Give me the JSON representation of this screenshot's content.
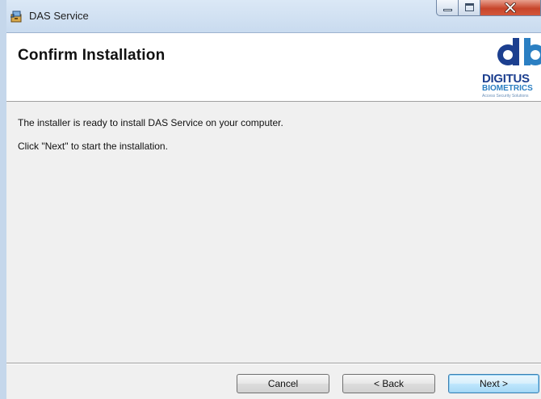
{
  "window": {
    "title": "DAS Service"
  },
  "banner": {
    "title": "Confirm Installation",
    "logo": {
      "name": "DIGITUS",
      "subtitle": "BIOMETRICS",
      "tagline": "Access Security Solutions",
      "colors": {
        "primary": "#1c3f8f",
        "secondary": "#2b7fc2"
      }
    }
  },
  "content": {
    "line1": "The installer is ready to install DAS Service on your computer.",
    "line2": "Click \"Next\" to start the installation."
  },
  "buttons": {
    "cancel": "Cancel",
    "back": "< Back",
    "next": "Next >"
  },
  "colors": {
    "close_button": "#c7452b",
    "next_button_border": "#3c7fb1",
    "window_frame": "#c5d7eb"
  }
}
